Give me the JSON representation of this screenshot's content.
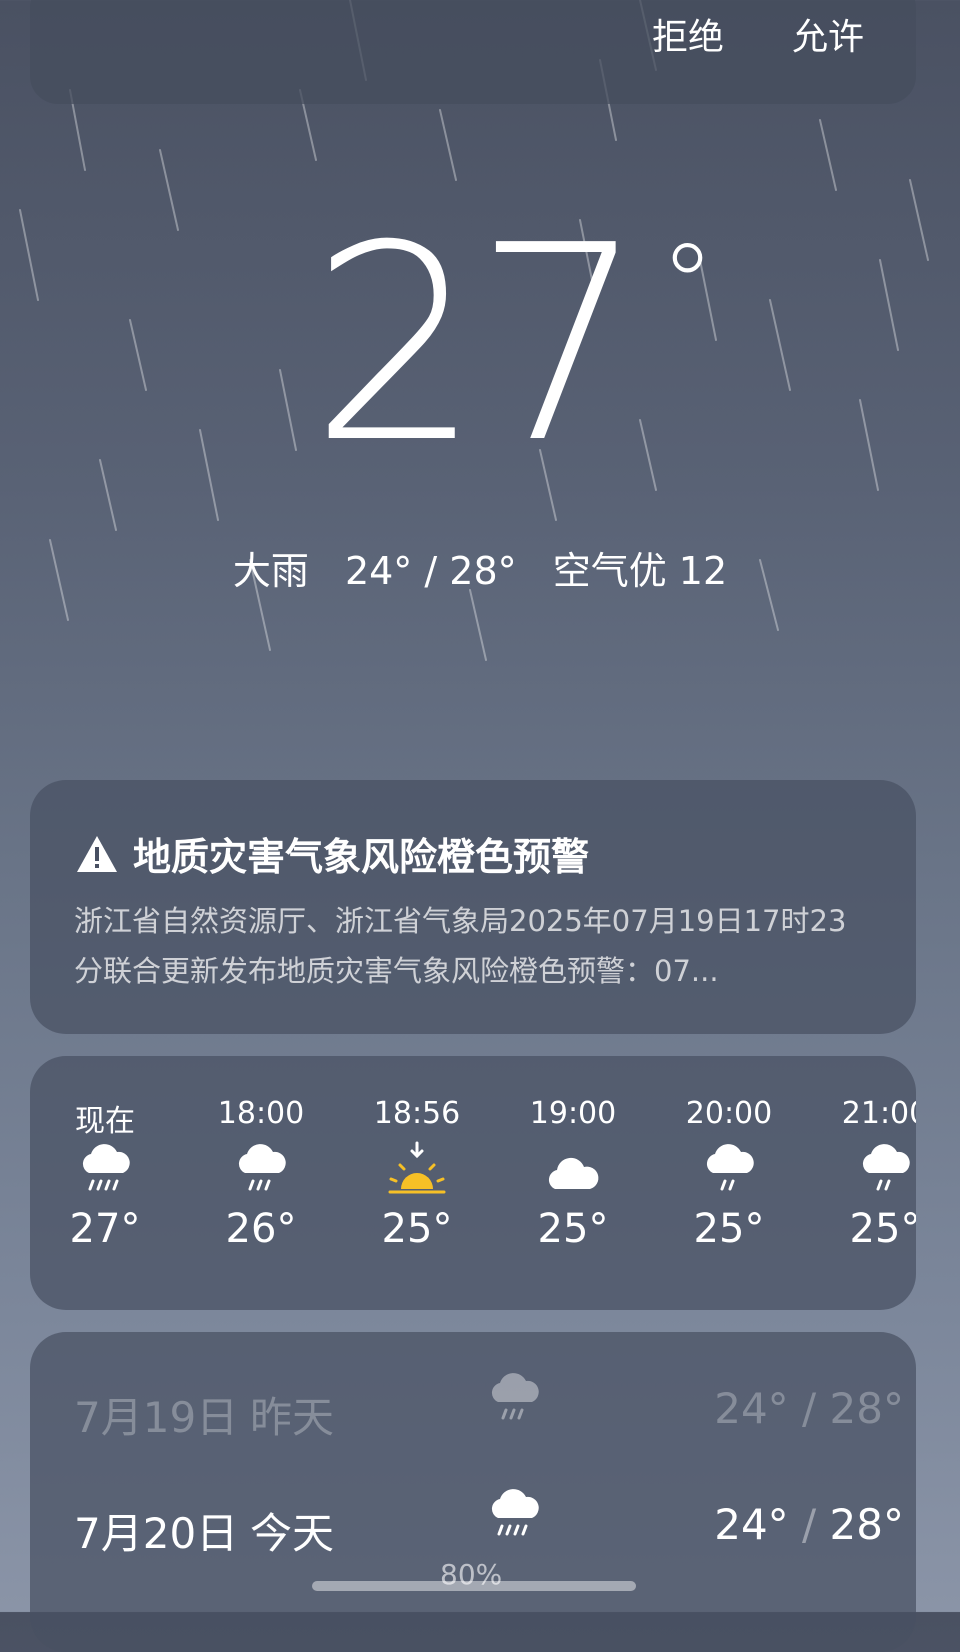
{
  "permission_banner": {
    "deny_label": "拒绝",
    "allow_label": "允许"
  },
  "current": {
    "temperature": "27",
    "degree": "°",
    "condition": "大雨",
    "range": "24° / 28°",
    "aqi": "空气优 12"
  },
  "alert": {
    "title": "地质灾害气象风险橙色预警",
    "body": "浙江省自然资源厅、浙江省气象局2025年07月19日17时23分联合更新发布地质灾害气象风险橙色预警：07..."
  },
  "hourly": [
    {
      "time": "现在",
      "icon": "rain-cloud-icon",
      "temp": "27°"
    },
    {
      "time": "18:00",
      "icon": "rain-cloud-icon",
      "temp": "26°"
    },
    {
      "time": "18:56",
      "icon": "sunset-icon",
      "temp": "25°"
    },
    {
      "time": "19:00",
      "icon": "cloud-icon",
      "temp": "25°"
    },
    {
      "time": "20:00",
      "icon": "rain-cloud-icon",
      "temp": "25°"
    },
    {
      "time": "21:00",
      "icon": "rain-cloud-icon",
      "temp": "25°"
    }
  ],
  "daily": [
    {
      "date": "7月19日",
      "name": "昨天",
      "icon": "rain-cloud-icon",
      "low": "24°",
      "sep": "/",
      "high": "28°"
    },
    {
      "date": "7月20日",
      "name": "今天",
      "icon": "heavy-rain-icon",
      "low": "24°",
      "sep": "/",
      "high": "28°",
      "precip": "80%"
    }
  ],
  "colors": {
    "sun": "#f6c026",
    "card": "#485062",
    "text_dim": "rgba(255,255,255,0.72)"
  }
}
